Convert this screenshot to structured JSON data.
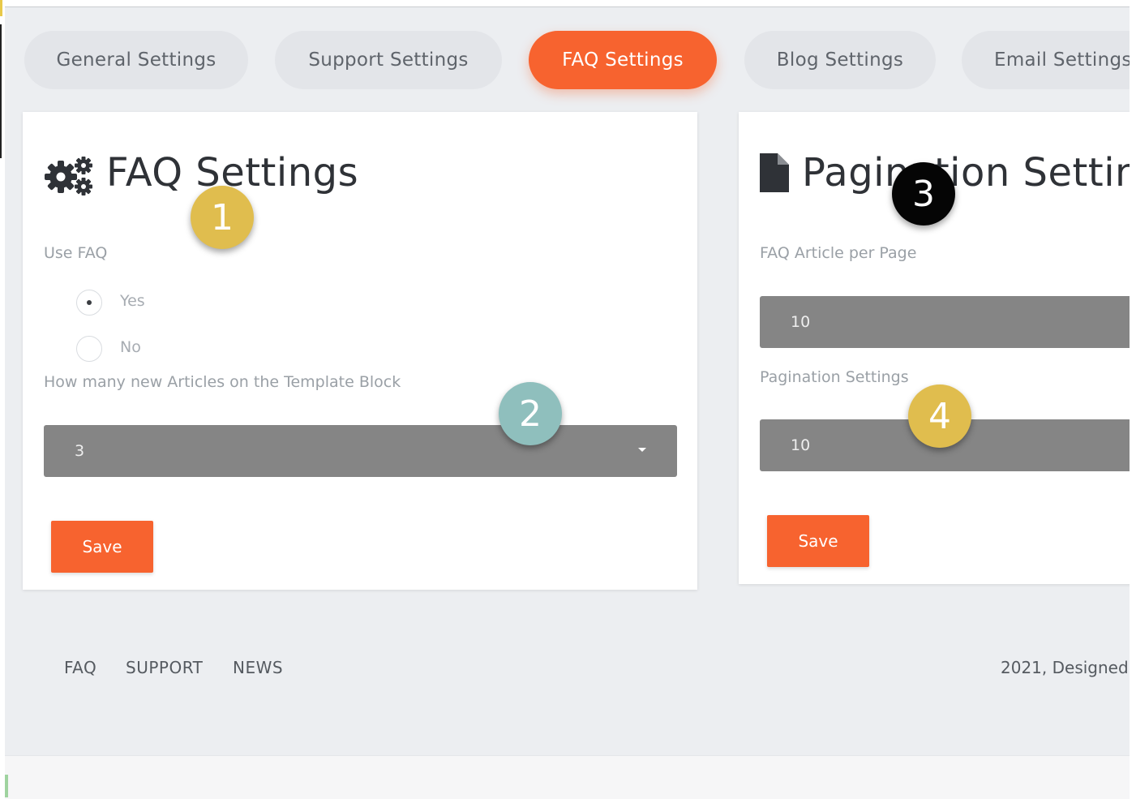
{
  "tabs": [
    {
      "label": "General Settings",
      "active": false
    },
    {
      "label": "Support Settings",
      "active": false
    },
    {
      "label": "FAQ Settings",
      "active": true
    },
    {
      "label": "Blog Settings",
      "active": false
    },
    {
      "label": "Email Settings",
      "active": false
    }
  ],
  "faq_card": {
    "icon": "cogs-icon",
    "title": "FAQ Settings",
    "use_faq_label": "Use FAQ",
    "options": [
      "Yes",
      "No"
    ],
    "selected_option": "Yes",
    "articles_label": "How many new Articles on the Template Block",
    "articles_value": "3",
    "save_label": "Save"
  },
  "pagination_card": {
    "icon": "file-icon",
    "title": "Pagination Settings",
    "per_page_label": "FAQ Article per Page",
    "per_page_value": "10",
    "pagination_label": "Pagination Settings",
    "pagination_value": "10",
    "save_label": "Save"
  },
  "footer": {
    "links": [
      "FAQ",
      "SUPPORT",
      "NEWS"
    ],
    "copyright": "2021, Designed"
  },
  "markers": [
    "1",
    "2",
    "3",
    "4"
  ],
  "colors": {
    "accent": "#f7632f",
    "background": "#eceef1",
    "field": "#858585",
    "marker_gold": "#e0bd4e",
    "marker_teal": "#8fbfbd",
    "marker_black": "#050505"
  }
}
